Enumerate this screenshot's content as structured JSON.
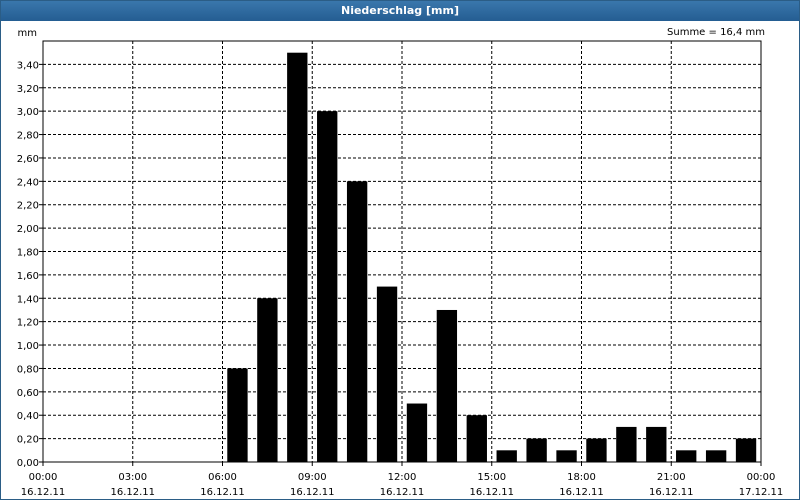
{
  "title": "Niederschlag [mm]",
  "chart_data": {
    "type": "bar",
    "title": "Niederschlag [mm]",
    "ylabel": "mm",
    "summary": "Summe = 16,4 mm",
    "ylim": [
      0,
      3.6
    ],
    "grid": true,
    "y_ticks": [
      "0,00",
      "0,20",
      "0,40",
      "0,60",
      "0,80",
      "1,00",
      "1,20",
      "1,40",
      "1,60",
      "1,80",
      "2,00",
      "2,20",
      "2,40",
      "2,60",
      "2,80",
      "3,00",
      "3,20",
      "3,40"
    ],
    "x_ticks": [
      {
        "time": "00:00",
        "date": "16.12.11"
      },
      {
        "time": "03:00",
        "date": "16.12.11"
      },
      {
        "time": "06:00",
        "date": "16.12.11"
      },
      {
        "time": "09:00",
        "date": "16.12.11"
      },
      {
        "time": "12:00",
        "date": "16.12.11"
      },
      {
        "time": "15:00",
        "date": "16.12.11"
      },
      {
        "time": "18:00",
        "date": "16.12.11"
      },
      {
        "time": "21:00",
        "date": "16.12.11"
      },
      {
        "time": "00:00",
        "date": "17.12.11"
      }
    ],
    "categories": [
      "00:00",
      "01:00",
      "02:00",
      "03:00",
      "04:00",
      "05:00",
      "06:00",
      "07:00",
      "08:00",
      "09:00",
      "10:00",
      "11:00",
      "12:00",
      "13:00",
      "14:00",
      "15:00",
      "16:00",
      "17:00",
      "18:00",
      "19:00",
      "20:00",
      "21:00",
      "22:00",
      "23:00"
    ],
    "values": [
      0,
      0,
      0,
      0,
      0,
      0,
      0.8,
      1.4,
      3.5,
      3.0,
      2.4,
      1.5,
      0.5,
      1.3,
      0.4,
      0.1,
      0.2,
      0.1,
      0.2,
      0.3,
      0.3,
      0.1,
      0.1,
      0.2
    ],
    "bar_color": "#000000"
  }
}
